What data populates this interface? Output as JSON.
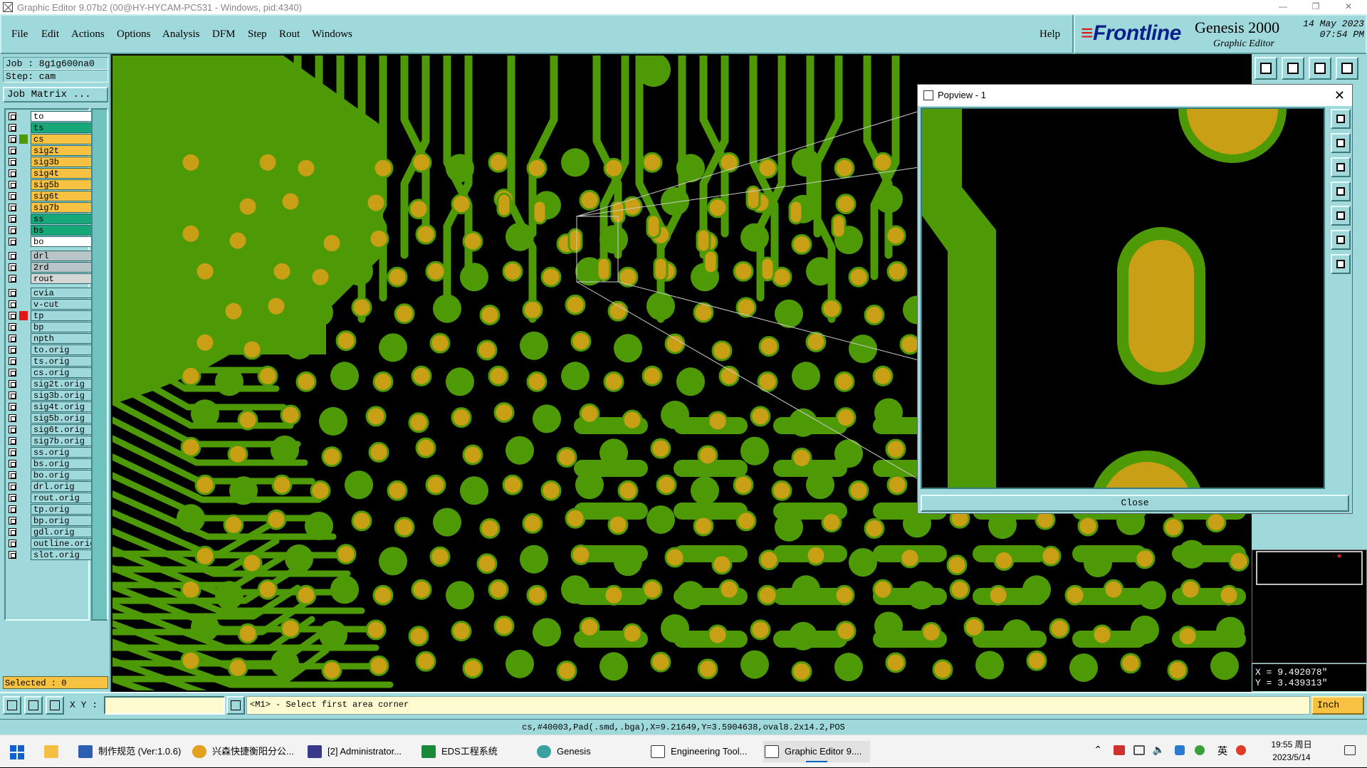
{
  "window": {
    "title": "Graphic Editor 9.07b2 (00@HY-HYCAM-PC531 - Windows, pid:4340)"
  },
  "menu": {
    "items": [
      "File",
      "Edit",
      "Actions",
      "Options",
      "Analysis",
      "DFM",
      "Step",
      "Rout",
      "Windows"
    ],
    "help": "Help"
  },
  "brand": {
    "logo": "Frontline",
    "product": "Genesis 2000",
    "subtitle": "Graphic Editor",
    "date": "14 May 2023",
    "time": "07:54 PM"
  },
  "job": {
    "job_line": "Job : 8g1g600na0",
    "step_line": "Step: cam",
    "matrix_button": "Job Matrix ..."
  },
  "layers": [
    {
      "name": "to",
      "color": "#ffffff",
      "mark": "none"
    },
    {
      "name": "ts",
      "color": "#17a87a",
      "mark": "none"
    },
    {
      "name": "cs",
      "color": "#f7c241",
      "mark": "green"
    },
    {
      "name": "sig2t",
      "color": "#f7c241",
      "mark": "none"
    },
    {
      "name": "sig3b",
      "color": "#f7c241",
      "mark": "none"
    },
    {
      "name": "sig4t",
      "color": "#f7c241",
      "mark": "none"
    },
    {
      "name": "sig5b",
      "color": "#f7c241",
      "mark": "none"
    },
    {
      "name": "sig6t",
      "color": "#f7c241",
      "mark": "none"
    },
    {
      "name": "sig7b",
      "color": "#f7c241",
      "mark": "none"
    },
    {
      "name": "ss",
      "color": "#17a87a",
      "mark": "none"
    },
    {
      "name": "bs",
      "color": "#17a87a",
      "mark": "none"
    },
    {
      "name": "bo",
      "color": "#ffffff",
      "mark": "none"
    },
    {
      "name": "drl",
      "color": "#b8c4c8",
      "mark": "none"
    },
    {
      "name": "2rd",
      "color": "#b8c4c8",
      "mark": "none"
    },
    {
      "name": "rout",
      "color": "#d6d6d6",
      "mark": "none"
    },
    {
      "name": "cvia",
      "color": "#9fd9dc",
      "mark": "none"
    },
    {
      "name": "v-cut",
      "color": "#9fd9dc",
      "mark": "none"
    },
    {
      "name": "tp",
      "color": "#9fd9dc",
      "mark": "red"
    },
    {
      "name": "bp",
      "color": "#9fd9dc",
      "mark": "none"
    },
    {
      "name": "npth",
      "color": "#9fd9dc",
      "mark": "none"
    },
    {
      "name": "to.orig",
      "color": "#9fd9dc",
      "mark": "none"
    },
    {
      "name": "ts.orig",
      "color": "#9fd9dc",
      "mark": "none"
    },
    {
      "name": "cs.orig",
      "color": "#9fd9dc",
      "mark": "none"
    },
    {
      "name": "sig2t.orig",
      "color": "#9fd9dc",
      "mark": "none"
    },
    {
      "name": "sig3b.orig",
      "color": "#9fd9dc",
      "mark": "none"
    },
    {
      "name": "sig4t.orig",
      "color": "#9fd9dc",
      "mark": "none"
    },
    {
      "name": "sig5b.orig",
      "color": "#9fd9dc",
      "mark": "none"
    },
    {
      "name": "sig6t.orig",
      "color": "#9fd9dc",
      "mark": "none"
    },
    {
      "name": "sig7b.orig",
      "color": "#9fd9dc",
      "mark": "none"
    },
    {
      "name": "ss.orig",
      "color": "#9fd9dc",
      "mark": "none"
    },
    {
      "name": "bs.orig",
      "color": "#9fd9dc",
      "mark": "none"
    },
    {
      "name": "bo.orig",
      "color": "#9fd9dc",
      "mark": "none"
    },
    {
      "name": "drl.orig",
      "color": "#9fd9dc",
      "mark": "none"
    },
    {
      "name": "rout.orig",
      "color": "#9fd9dc",
      "mark": "none"
    },
    {
      "name": "tp.orig",
      "color": "#9fd9dc",
      "mark": "none"
    },
    {
      "name": "bp.orig",
      "color": "#9fd9dc",
      "mark": "none"
    },
    {
      "name": "gdl.orig",
      "color": "#9fd9dc",
      "mark": "none"
    },
    {
      "name": "outline.orig",
      "color": "#9fd9dc",
      "mark": "none"
    },
    {
      "name": "slot.orig",
      "color": "#9fd9dc",
      "mark": "none"
    }
  ],
  "selected": "Selected : 0",
  "popview": {
    "title": "Popview - 1",
    "close_label": "Close"
  },
  "coords": {
    "x": "X = 9.492078\"",
    "y": "Y = 3.439313\""
  },
  "command": {
    "xy_label": "X Y :",
    "xy_value": "",
    "prompt": "<M1> - Select first area corner",
    "unit": "Inch"
  },
  "status": "cs,#40003,Pad(.smd,.bga),X=9.21649,Y=3.5904638,oval8.2x14.2,POS",
  "taskbar": {
    "items": [
      "制作规范 (Ver:1.0.6)",
      "兴森快捷衡阳分公...",
      "[2] Administrator...",
      "EDS工程系统",
      "Genesis",
      "Engineering Tool...",
      "Graphic Editor 9...."
    ],
    "clock_time": "19:55 周日",
    "clock_date": "2023/5/14",
    "ime": "英"
  },
  "colors": {
    "ui_teal": "#9fd9dc",
    "copper_green": "#4e9a06",
    "pad_gold": "#c9a015",
    "canvas_bg": "#000000"
  }
}
